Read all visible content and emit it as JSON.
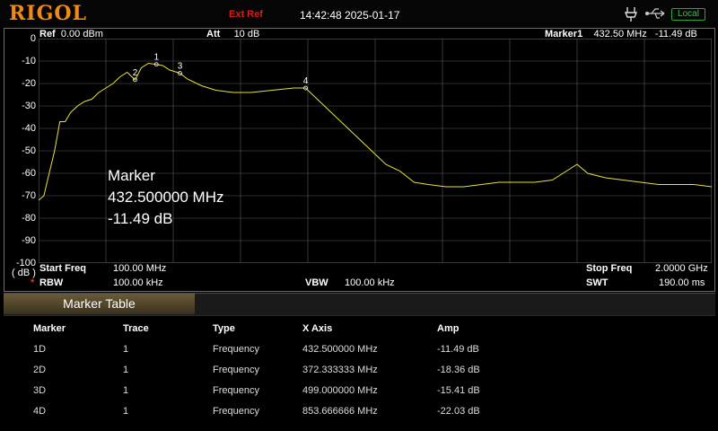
{
  "topbar": {
    "logo": "RIGOL",
    "ext_ref": "Ext Ref",
    "datetime": "14:42:48 2025-01-17",
    "local_label": "Local"
  },
  "header": {
    "ref_label": "Ref",
    "ref_value": "0.00 dBm",
    "att_label": "Att",
    "att_value": "10 dB",
    "marker_label": "Marker1",
    "marker_value": "432.50 MHz   -11.49 dB"
  },
  "yaxis": {
    "ticks": [
      "0",
      "-10",
      "-20",
      "-30",
      "-40",
      "-50",
      "-60",
      "-70",
      "-80",
      "-90",
      "-100"
    ],
    "unit": "( dB )"
  },
  "bottom": {
    "start_label": "Start Freq",
    "start_value": "100.00 MHz",
    "stop_label": "Stop Freq",
    "stop_value": "2.0000 GHz",
    "rbw_label": "RBW",
    "rbw_star": "*",
    "rbw_value": "100.00 kHz",
    "vbw_label": "VBW",
    "vbw_value": "100.00 kHz",
    "swt_label": "SWT",
    "swt_value": "190.00 ms"
  },
  "overlay": {
    "title": "Marker",
    "freq": "432.500000 MHz",
    "amp": "-11.49 dB"
  },
  "colors": {
    "trace": "#e8e23a",
    "grid": "#5a5a5a",
    "logo": "#f08a16",
    "ext_ref": "#e01818",
    "local": "#2ad13a"
  },
  "chart_data": {
    "type": "line",
    "x_unit": "MHz",
    "y_unit": "dB",
    "xlim": [
      100,
      2000
    ],
    "ylim": [
      -100,
      0
    ],
    "grid": true,
    "series": [
      {
        "x": [
          100,
          115,
          130,
          145,
          160,
          175,
          190,
          210,
          230,
          250,
          270,
          290,
          310,
          330,
          350,
          372.3,
          390,
          410,
          432.5,
          450,
          470,
          499,
          520,
          560,
          600,
          650,
          700,
          760,
          820,
          853.7,
          880,
          920,
          960,
          1000,
          1040,
          1080,
          1120,
          1160,
          1200,
          1250,
          1300,
          1350,
          1400,
          1450,
          1500,
          1550,
          1580,
          1600,
          1620,
          1650,
          1700,
          1750,
          1800,
          1850,
          1900,
          1950,
          2000
        ],
        "y": [
          -72,
          -70,
          -60,
          -50,
          -37,
          -37,
          -33,
          -30,
          -28,
          -27,
          -24,
          -22,
          -20,
          -17,
          -15,
          -18.4,
          -13,
          -11,
          -11.5,
          -12,
          -14,
          -15.4,
          -18,
          -21,
          -23,
          -24,
          -24,
          -23,
          -22,
          -22,
          -26,
          -32,
          -38,
          -44,
          -50,
          -56,
          -59,
          -64,
          -65,
          -66,
          -66,
          -65,
          -64,
          -64,
          -64,
          -63,
          -60,
          -58,
          -56,
          -60,
          -62,
          -63,
          -64,
          -65,
          -65,
          -65,
          -66
        ]
      }
    ],
    "markers": [
      {
        "label": "1",
        "x": 432.5,
        "y": -11.49
      },
      {
        "label": "2",
        "x": 372.333333,
        "y": -18.36
      },
      {
        "label": "3",
        "x": 499.0,
        "y": -15.41
      },
      {
        "label": "4",
        "x": 853.666666,
        "y": -22.03
      }
    ]
  },
  "marker_table": {
    "tab_label": "Marker Table",
    "columns": [
      "Marker",
      "Trace",
      "Type",
      "X Axis",
      "Amp"
    ],
    "rows": [
      [
        "1D",
        "1",
        "Frequency",
        "432.500000 MHz",
        "-11.49 dB"
      ],
      [
        "2D",
        "1",
        "Frequency",
        "372.333333 MHz",
        "-18.36 dB"
      ],
      [
        "3D",
        "1",
        "Frequency",
        "499.000000 MHz",
        "-15.41 dB"
      ],
      [
        "4D",
        "1",
        "Frequency",
        "853.666666 MHz",
        "-22.03 dB"
      ]
    ]
  }
}
